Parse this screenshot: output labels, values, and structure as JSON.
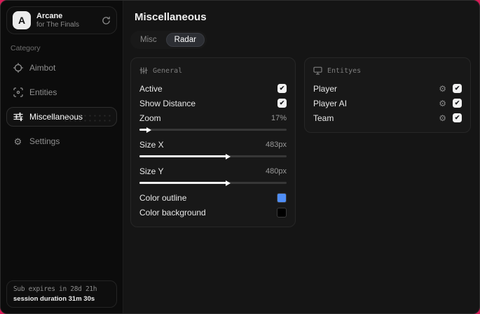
{
  "app": {
    "initial": "A",
    "name": "Arcane",
    "subtitle": "for The Finals"
  },
  "sidebar": {
    "category_label": "Category",
    "items": [
      {
        "label": "Aimbot"
      },
      {
        "label": "Entities"
      },
      {
        "label": "Miscellaneous"
      },
      {
        "label": "Settings"
      }
    ],
    "footer": {
      "sub_expiry": "Sub expires in 28d 21h",
      "session_duration": "session duration 31m 30s"
    }
  },
  "main": {
    "title": "Miscellaneous",
    "tabs": [
      {
        "label": "Misc"
      },
      {
        "label": "Radar"
      }
    ],
    "active_tab": "Radar",
    "panels": {
      "general": {
        "title": "General",
        "active": {
          "label": "Active",
          "checked": true
        },
        "show_distance": {
          "label": "Show Distance",
          "checked": true
        },
        "zoom": {
          "label": "Zoom",
          "value": "17%",
          "fill": 6
        },
        "size_x": {
          "label": "Size X",
          "value": "483px",
          "fill": 60
        },
        "size_y": {
          "label": "Size Y",
          "value": "480px",
          "fill": 60
        },
        "color_outline": {
          "label": "Color outline",
          "color": "#4f8ef7"
        },
        "color_background": {
          "label": "Color background",
          "color": "#000000"
        }
      },
      "entities": {
        "title": "Entityes",
        "rows": [
          {
            "label": "Player",
            "checked": true
          },
          {
            "label": "Player AI",
            "checked": true
          },
          {
            "label": "Team",
            "checked": true
          }
        ]
      }
    }
  },
  "icons": {
    "check": "✔",
    "gear": "⚙"
  },
  "colors": {
    "accent_background": "#d81b57",
    "outline_swatch": "#4f8ef7",
    "background_swatch": "#000000"
  }
}
